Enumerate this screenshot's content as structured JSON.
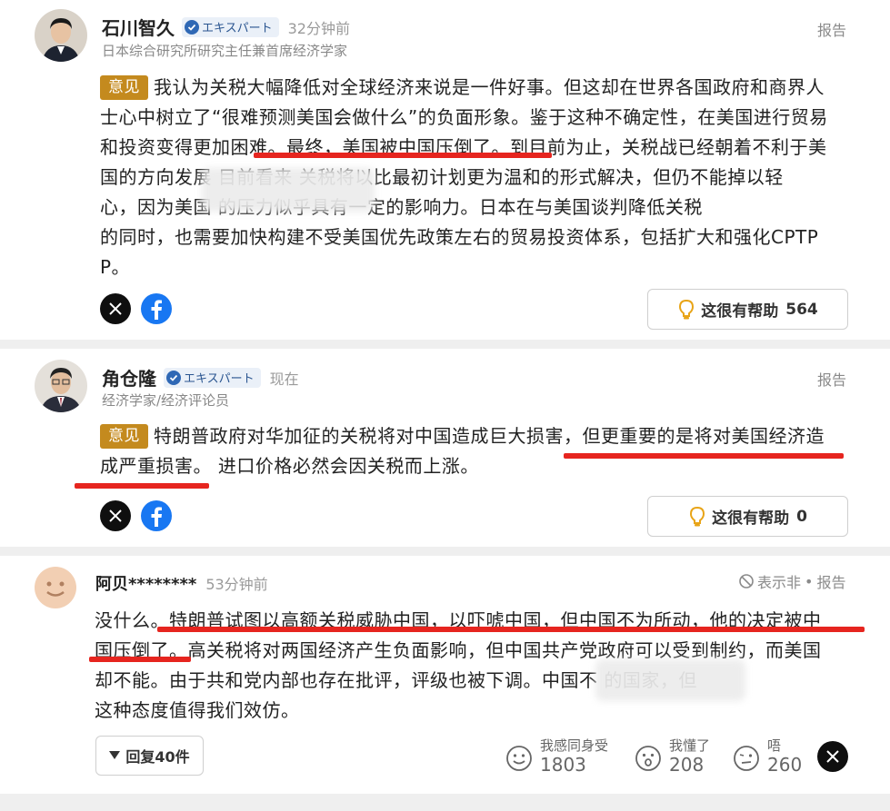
{
  "comments": [
    {
      "author": "石川智久",
      "badge": "エキスパート",
      "time": "32分钟前",
      "title": "日本综合研究所研究主任兼首席经济学家",
      "report": "报告",
      "tag": "意见",
      "lines": [
        "我认为关税大幅降低对全球经济来说是一件好事。但这却在世界各国政府和商界人",
        "士心中树立了“很难预测美国会做什么”的负面形象。鉴于这种不确定性，在美国进行贸易",
        "和投资变得更加困难。最终，美国被中国压倒了。到目前为止，关税战已经朝着不利于美",
        "国的方向发展     目前看来    关税将以比最初计划更为温和的形式解决，但仍不能掉以轻",
        "心，因为美国                        的压力似乎具有一定的影响力。日本在与美国谈判降低关税",
        "的同时，也需要加快构建不受美国优先政策左右的贸易投资体系，包括扩大和强化CPTP",
        "P。"
      ],
      "helpful_label": "这很有帮助",
      "helpful_count": "564"
    },
    {
      "author": "角仓隆",
      "badge": "エキスパート",
      "time": "现在",
      "title": "经济学家/经济评论员",
      "report": "报告",
      "tag": "意见",
      "lines": [
        "特朗普政府对华加征的关税将对中国造成巨大损害，但更重要的是将对美国经济造",
        "成严重损害。  进口价格必然会因关税而上涨。"
      ],
      "helpful_label": "这很有帮助",
      "helpful_count": "0"
    },
    {
      "author": "阿贝********",
      "time": "53分钟前",
      "hide_label": "表示非",
      "report": "报告",
      "lines": [
        "没什么。特朗普试图以高额关税威胁中国，以吓唬中国，但中国不为所动，他的决定被中",
        "国压倒了。高关税将对两国经济产生负面影响，但中国共产党政府可以受到制约，而美国",
        "却不能。由于共和党内部也存在批评，评级也被下调。中国不                        的国家，但",
        "这种态度值得我们效仿。"
      ],
      "reply_label": "回复40件",
      "reactions": [
        {
          "label": "我感同身受",
          "count": "1803"
        },
        {
          "label": "我懂了",
          "count": "208"
        },
        {
          "label": "唔",
          "count": "260"
        }
      ]
    }
  ]
}
